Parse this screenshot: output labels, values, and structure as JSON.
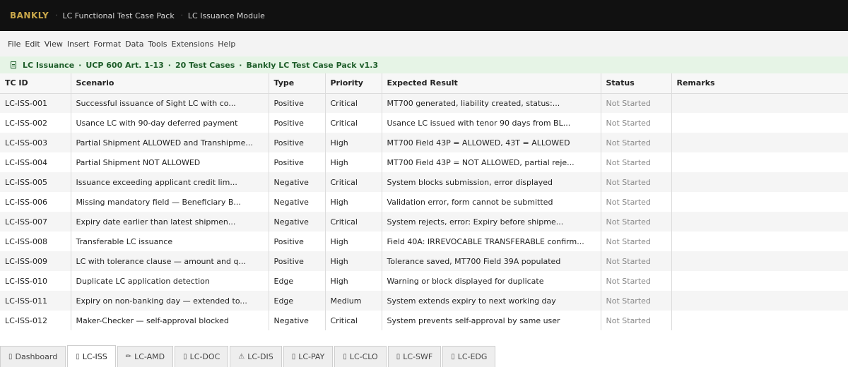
{
  "topbar": {
    "brand": "BANKLY",
    "crumbs": [
      "LC Functional Test Case Pack",
      "LC Issuance Module"
    ],
    "separator": "·"
  },
  "menu": [
    "File",
    "Edit",
    "View",
    "Insert",
    "Format",
    "Data",
    "Tools",
    "Extensions",
    "Help"
  ],
  "info": {
    "icon": "document-icon",
    "parts": [
      "LC Issuance",
      "UCP 600 Art. 1-13",
      "20 Test Cases",
      "Bankly LC Test Case Pack v1.3"
    ],
    "separator": "·",
    "color": "#1e5e2a"
  },
  "table": {
    "headers": [
      "TC ID",
      "Scenario",
      "Type",
      "Priority",
      "Expected Result",
      "Status",
      "Remarks"
    ],
    "rows": [
      [
        "LC-ISS-001",
        "Successful issuance of Sight LC with co...",
        "Positive",
        "Critical",
        "MT700 generated, liability created, status:...",
        "Not Started",
        ""
      ],
      [
        "LC-ISS-002",
        "Usance LC with 90-day deferred payment",
        "Positive",
        "Critical",
        "Usance LC issued with tenor 90 days from BL...",
        "Not Started",
        ""
      ],
      [
        "LC-ISS-003",
        "Partial Shipment ALLOWED and Transhipme...",
        "Positive",
        "High",
        "MT700 Field 43P = ALLOWED, 43T = ALLOWED",
        "Not Started",
        ""
      ],
      [
        "LC-ISS-004",
        "Partial Shipment NOT ALLOWED",
        "Positive",
        "High",
        "MT700 Field 43P = NOT ALLOWED, partial reje...",
        "Not Started",
        ""
      ],
      [
        "LC-ISS-005",
        "Issuance exceeding applicant credit lim...",
        "Negative",
        "Critical",
        "System blocks submission, error displayed",
        "Not Started",
        ""
      ],
      [
        "LC-ISS-006",
        "Missing mandatory field — Beneficiary B...",
        "Negative",
        "High",
        "Validation error, form cannot be submitted",
        "Not Started",
        ""
      ],
      [
        "LC-ISS-007",
        "Expiry date earlier than latest shipmen...",
        "Negative",
        "Critical",
        "System rejects, error: Expiry before shipme...",
        "Not Started",
        ""
      ],
      [
        "LC-ISS-008",
        "Transferable LC issuance",
        "Positive",
        "High",
        "Field 40A: IRREVOCABLE TRANSFERABLE confirm...",
        "Not Started",
        ""
      ],
      [
        "LC-ISS-009",
        "LC with tolerance clause — amount and q...",
        "Positive",
        "High",
        "Tolerance saved, MT700 Field 39A populated",
        "Not Started",
        ""
      ],
      [
        "LC-ISS-010",
        "Duplicate LC application detection",
        "Edge",
        "High",
        "Warning or block displayed for duplicate",
        "Not Started",
        ""
      ],
      [
        "LC-ISS-011",
        "Expiry on non-banking day — extended to...",
        "Edge",
        "Medium",
        "System extends expiry to next working day",
        "Not Started",
        ""
      ],
      [
        "LC-ISS-012",
        "Maker-Checker — self-approval blocked",
        "Negative",
        "Critical",
        "System prevents self-approval by same user",
        "Not Started",
        ""
      ]
    ]
  },
  "tabs": [
    {
      "label": "Dashboard",
      "icon": "dashboard-icon",
      "glyph": "▯",
      "active": false
    },
    {
      "label": "LC-ISS",
      "icon": "document-icon",
      "glyph": "▯",
      "active": true
    },
    {
      "label": "LC-AMD",
      "icon": "pencil-icon",
      "glyph": "✏",
      "active": false
    },
    {
      "label": "LC-DOC",
      "icon": "folder-icon",
      "glyph": "▯",
      "active": false
    },
    {
      "label": "LC-DIS",
      "icon": "warning-icon",
      "glyph": "⚠",
      "active": false
    },
    {
      "label": "LC-PAY",
      "icon": "payment-icon",
      "glyph": "▯",
      "active": false
    },
    {
      "label": "LC-CLO",
      "icon": "lock-icon",
      "glyph": "▯",
      "active": false
    },
    {
      "label": "LC-SWF",
      "icon": "swift-icon",
      "glyph": "▯",
      "active": false
    },
    {
      "label": "LC-EDG",
      "icon": "edge-icon",
      "glyph": "▯",
      "active": false
    }
  ],
  "colors": {
    "brand": "#c9a74a",
    "topbar": "#111111",
    "info_bg": "#e6f4e6",
    "status_text": "#888888"
  }
}
